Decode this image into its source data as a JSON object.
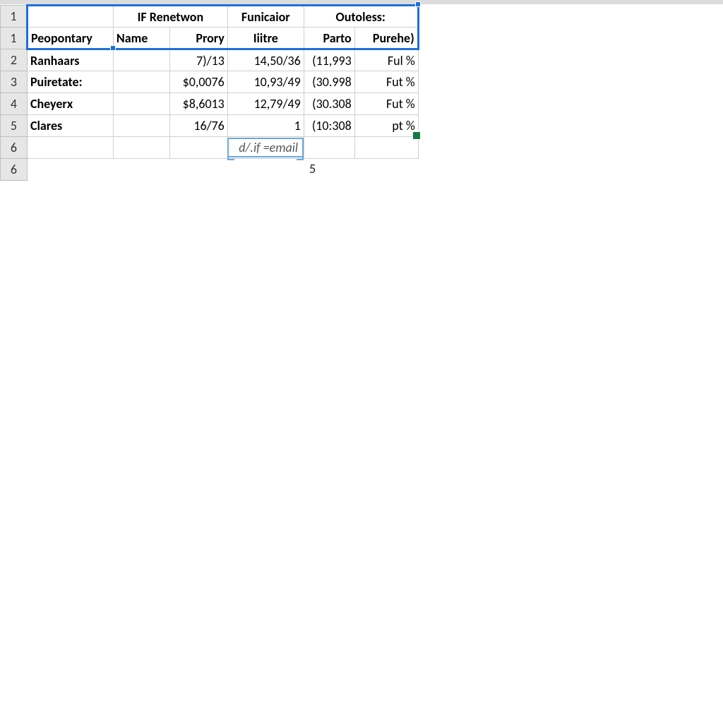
{
  "colors": {
    "selection_border": "#1f6fd6",
    "fill_handle": "#107c41",
    "edit_border": "#6ea8dc"
  },
  "row_headers": [
    "1",
    "1",
    "2",
    "3",
    "4",
    "5",
    "6",
    "6"
  ],
  "merged_headers": {
    "col_bc": "IF Renetwon",
    "col_d": "Funicaior",
    "col_ef": "Outoless:"
  },
  "sub_headers": {
    "a": "Peopontary",
    "b": "Name",
    "c": "Prory",
    "d": "Iiitre",
    "e": "Parto",
    "f": "Purehe)"
  },
  "rows": [
    {
      "a": "Ranhaars",
      "c": "7)/13",
      "d": "14,50/36",
      "e": "(11,993",
      "f": "Ful %"
    },
    {
      "a": "Puiretate:",
      "c": "$0,0076",
      "d": "10,93/49",
      "e": "(30.998",
      "f": "Fut %"
    },
    {
      "a": "Cheyerx",
      "c": "$8,6013",
      "d": "12,79/49",
      "e": "(30.308",
      "f": "Fut %"
    },
    {
      "a": "Clares",
      "c": "16/76",
      "d": "1",
      "e": "(10:308",
      "f": "pt %"
    }
  ],
  "editing": {
    "value": "d/.if =email"
  },
  "stray_label": "5"
}
